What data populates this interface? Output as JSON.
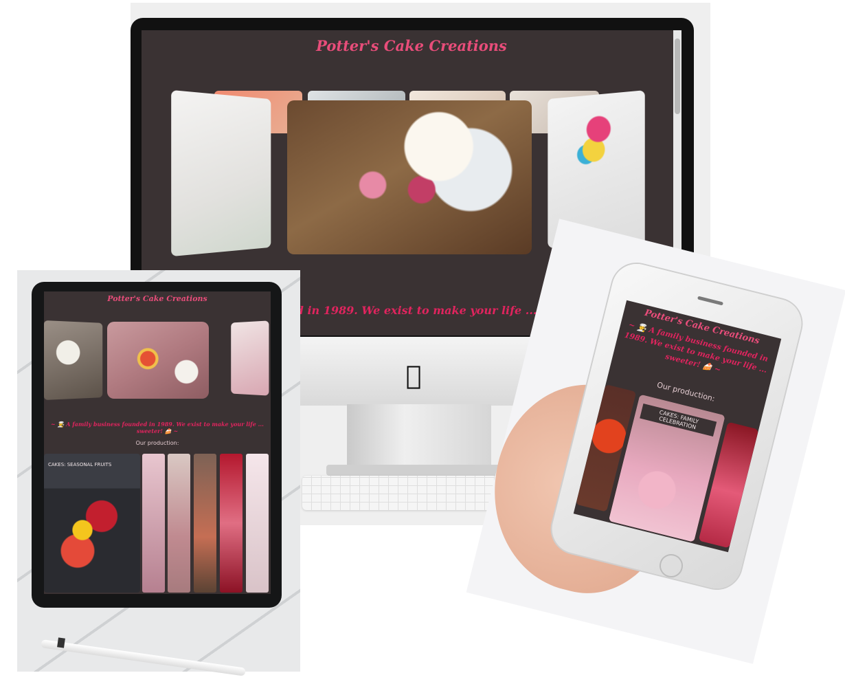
{
  "desktop": {
    "title": "Potter's Cake Creations",
    "tagline": "ess founded in 1989. We exist to make your life ... sweeter!"
  },
  "tablet": {
    "title": "Potter's Cake Creations",
    "tagline": "~ 👨‍🍳 A family business founded in 1989. We exist to make your life ... sweeter! 🍰 ~",
    "production_label": "Our production:",
    "main_card_label": "CAKES: SEASONAL FRUITS"
  },
  "phone": {
    "title": "Potter's Cake Creations",
    "tagline": "~ 👨‍🍳 A family business founded in 1989. We exist to make your life ... sweeter! 🍰 ~",
    "production_label": "Our production:",
    "main_card_label": "CAKES: FAMILY CELEBRATION"
  },
  "colors": {
    "page_background": "#3a3233",
    "title_accent": "#e84d7a",
    "tagline_accent": "#e0245e"
  },
  "icons": [
    "apple-logo-icon"
  ]
}
